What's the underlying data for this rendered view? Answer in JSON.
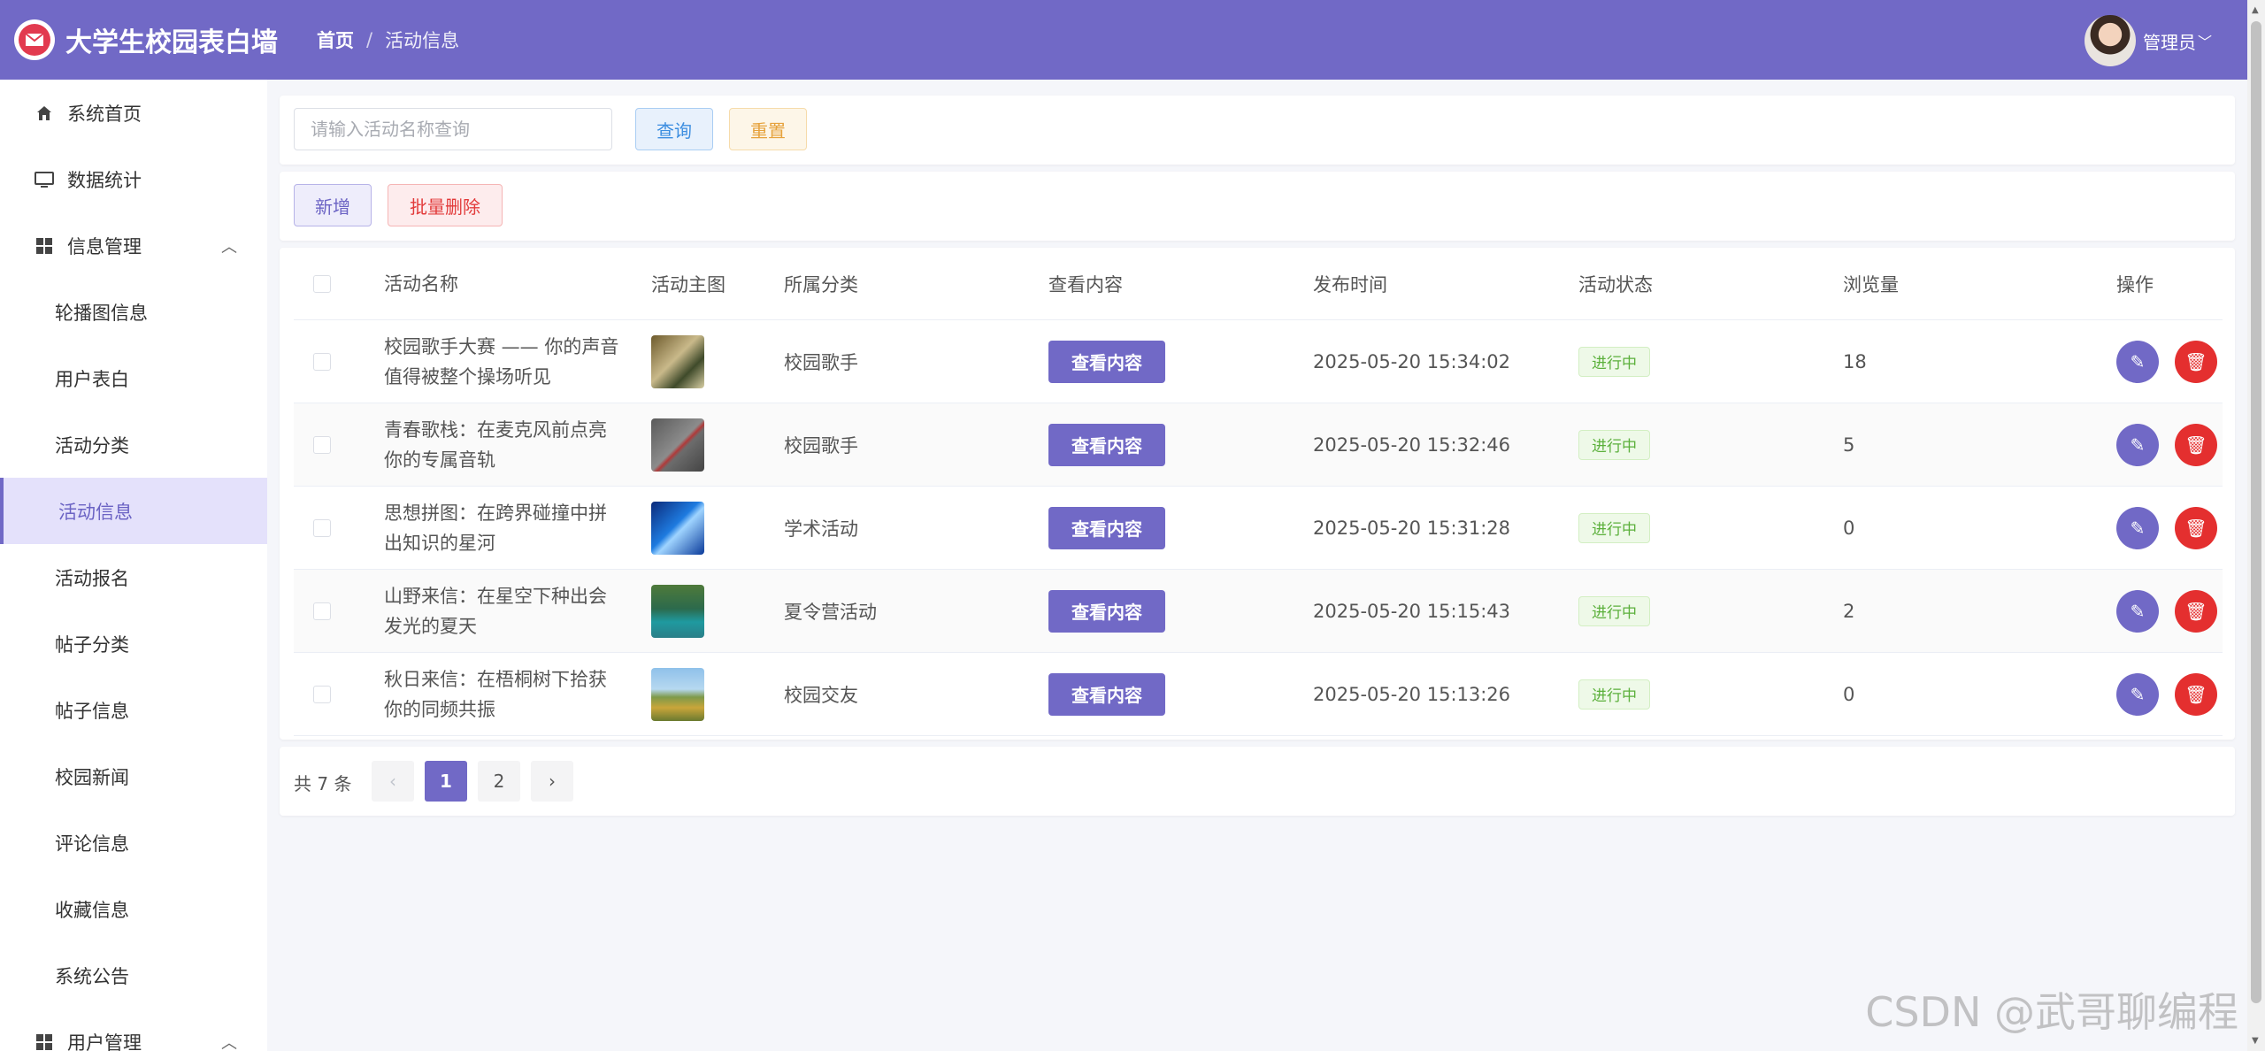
{
  "app": {
    "title": "大学生校园表白墙"
  },
  "breadcrumb": {
    "home": "首页",
    "separator": "/",
    "current": "活动信息"
  },
  "user": {
    "name": "管理员",
    "caret": "﹀"
  },
  "sidebar": {
    "items": [
      {
        "label": "系统首页",
        "icon": "home-icon"
      },
      {
        "label": "数据统计",
        "icon": "monitor-icon"
      },
      {
        "label": "信息管理",
        "icon": "grid-icon",
        "caret": "︿"
      },
      {
        "label": "轮播图信息"
      },
      {
        "label": "用户表白"
      },
      {
        "label": "活动分类"
      },
      {
        "label": "活动信息"
      },
      {
        "label": "活动报名"
      },
      {
        "label": "帖子分类"
      },
      {
        "label": "帖子信息"
      },
      {
        "label": "校园新闻"
      },
      {
        "label": "评论信息"
      },
      {
        "label": "收藏信息"
      },
      {
        "label": "系统公告"
      },
      {
        "label": "用户管理",
        "icon": "grid-icon",
        "caret": "︿"
      }
    ]
  },
  "search": {
    "placeholder": "请输入活动名称查询",
    "query_label": "查询",
    "reset_label": "重置"
  },
  "actions": {
    "add_label": "新增",
    "batch_delete_label": "批量删除"
  },
  "table": {
    "headers": [
      "活动名称",
      "活动主图",
      "所属分类",
      "查看内容",
      "发布时间",
      "活动状态",
      "浏览量",
      "操作"
    ],
    "view_label": "查看内容",
    "rows": [
      {
        "name": "校园歌手大赛 —— 你的声音值得被整个操场听见",
        "category": "校园歌手",
        "time": "2025-05-20 15:34:02",
        "status": "进行中",
        "views": "18"
      },
      {
        "name": "青春歌栈：在麦克风前点亮你的专属音轨",
        "category": "校园歌手",
        "time": "2025-05-20 15:32:46",
        "status": "进行中",
        "views": "5"
      },
      {
        "name": "思想拼图：在跨界碰撞中拼出知识的星河",
        "category": "学术活动",
        "time": "2025-05-20 15:31:28",
        "status": "进行中",
        "views": "0"
      },
      {
        "name": "山野来信：在星空下种出会发光的夏天",
        "category": "夏令营活动",
        "time": "2025-05-20 15:15:43",
        "status": "进行中",
        "views": "2"
      },
      {
        "name": "秋日来信：在梧桐树下拾获你的同频共振",
        "category": "校园交友",
        "time": "2025-05-20 15:13:26",
        "status": "进行中",
        "views": "0"
      }
    ]
  },
  "pagination": {
    "total": "共 7 条",
    "prev": "‹",
    "pages": [
      "1",
      "2"
    ],
    "next": "›",
    "current": "1"
  },
  "watermark": "CSDN @武哥聊编程",
  "colors": {
    "primary": "#7169c6",
    "danger": "#e42f2f",
    "success": "#5bb03b"
  }
}
